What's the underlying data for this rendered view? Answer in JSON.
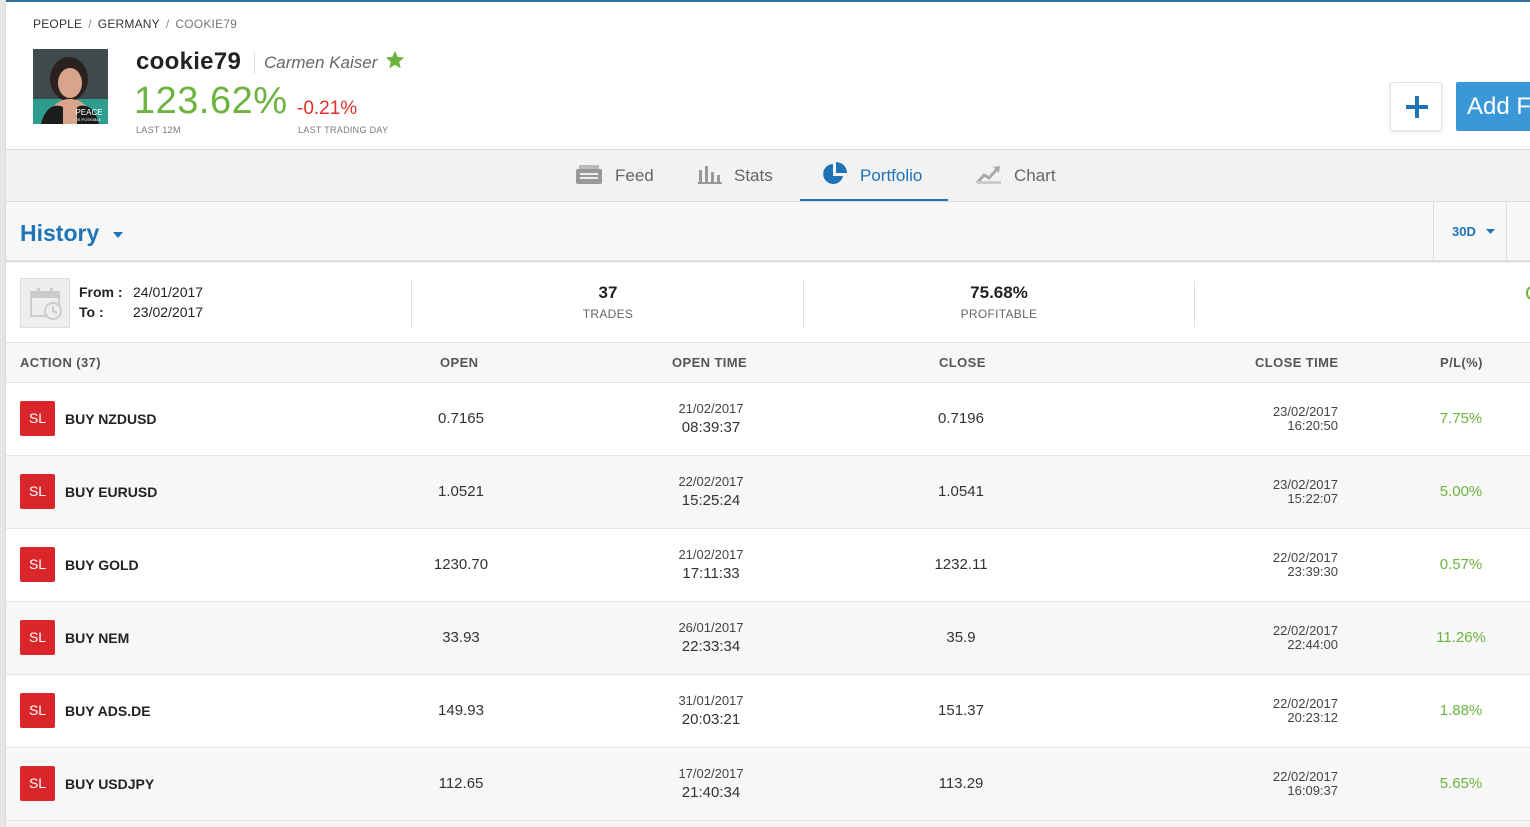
{
  "breadcrumb": [
    "PEOPLE",
    "GERMANY",
    "COOKIE79"
  ],
  "profile": {
    "username": "cookie79",
    "real_name": "Carmen Kaiser",
    "avatar_caption": "PEACE",
    "avatar_subcaption": "IS POSSIBLE",
    "gain": "123.62%",
    "gain_label": "LAST 12M",
    "day_change": "-0.21%",
    "day_change_label": "LAST TRADING DAY"
  },
  "actions": {
    "add_label": "Add F"
  },
  "tabs": [
    {
      "label": "Feed",
      "icon": "feed-icon"
    },
    {
      "label": "Stats",
      "icon": "stats-icon"
    },
    {
      "label": "Portfolio",
      "icon": "pie-chart-icon",
      "active": true
    },
    {
      "label": "Chart",
      "icon": "chart-icon"
    }
  ],
  "history": {
    "title": "History",
    "period": "30D"
  },
  "summary": {
    "from_label": "From :",
    "from_value": "24/01/2017",
    "to_label": "To :",
    "to_value": "23/02/2017",
    "trades_value": "37",
    "trades_label": "TRADES",
    "profitable_value": "75.68%",
    "profitable_label": "PROFITABLE"
  },
  "table": {
    "headers": {
      "action": "ACTION (37)",
      "open": "OPEN",
      "open_time": "OPEN TIME",
      "close": "CLOSE",
      "close_time": "CLOSE TIME",
      "pl": "P/L(%)"
    },
    "rows": [
      {
        "badge": "SL",
        "action": "BUY NZDUSD",
        "open": "0.7165",
        "open_date": "21/02/2017",
        "open_time": "08:39:37",
        "close": "0.7196",
        "close_date": "23/02/2017",
        "close_time": "16:20:50",
        "pl": "7.75%"
      },
      {
        "badge": "SL",
        "action": "BUY EURUSD",
        "open": "1.0521",
        "open_date": "22/02/2017",
        "open_time": "15:25:24",
        "close": "1.0541",
        "close_date": "23/02/2017",
        "close_time": "15:22:07",
        "pl": "5.00%"
      },
      {
        "badge": "SL",
        "action": "BUY GOLD",
        "open": "1230.70",
        "open_date": "21/02/2017",
        "open_time": "17:11:33",
        "close": "1232.11",
        "close_date": "22/02/2017",
        "close_time": "23:39:30",
        "pl": "0.57%"
      },
      {
        "badge": "SL",
        "action": "BUY NEM",
        "open": "33.93",
        "open_date": "26/01/2017",
        "open_time": "22:33:34",
        "close": "35.9",
        "close_date": "22/02/2017",
        "close_time": "22:44:00",
        "pl": "11.26%"
      },
      {
        "badge": "SL",
        "action": "BUY ADS.DE",
        "open": "149.93",
        "open_date": "31/01/2017",
        "open_time": "20:03:21",
        "close": "151.37",
        "close_date": "22/02/2017",
        "close_time": "20:23:12",
        "pl": "1.88%"
      },
      {
        "badge": "SL",
        "action": "BUY USDJPY",
        "open": "112.65",
        "open_date": "17/02/2017",
        "open_time": "21:40:34",
        "close": "113.29",
        "close_date": "22/02/2017",
        "close_time": "16:09:37",
        "pl": "5.65%"
      }
    ]
  },
  "colors": {
    "accent": "#1f74b8",
    "gain": "#6cb33f",
    "loss": "#e0302c",
    "badge": "#d9262a",
    "add_button": "#3b98d8"
  }
}
